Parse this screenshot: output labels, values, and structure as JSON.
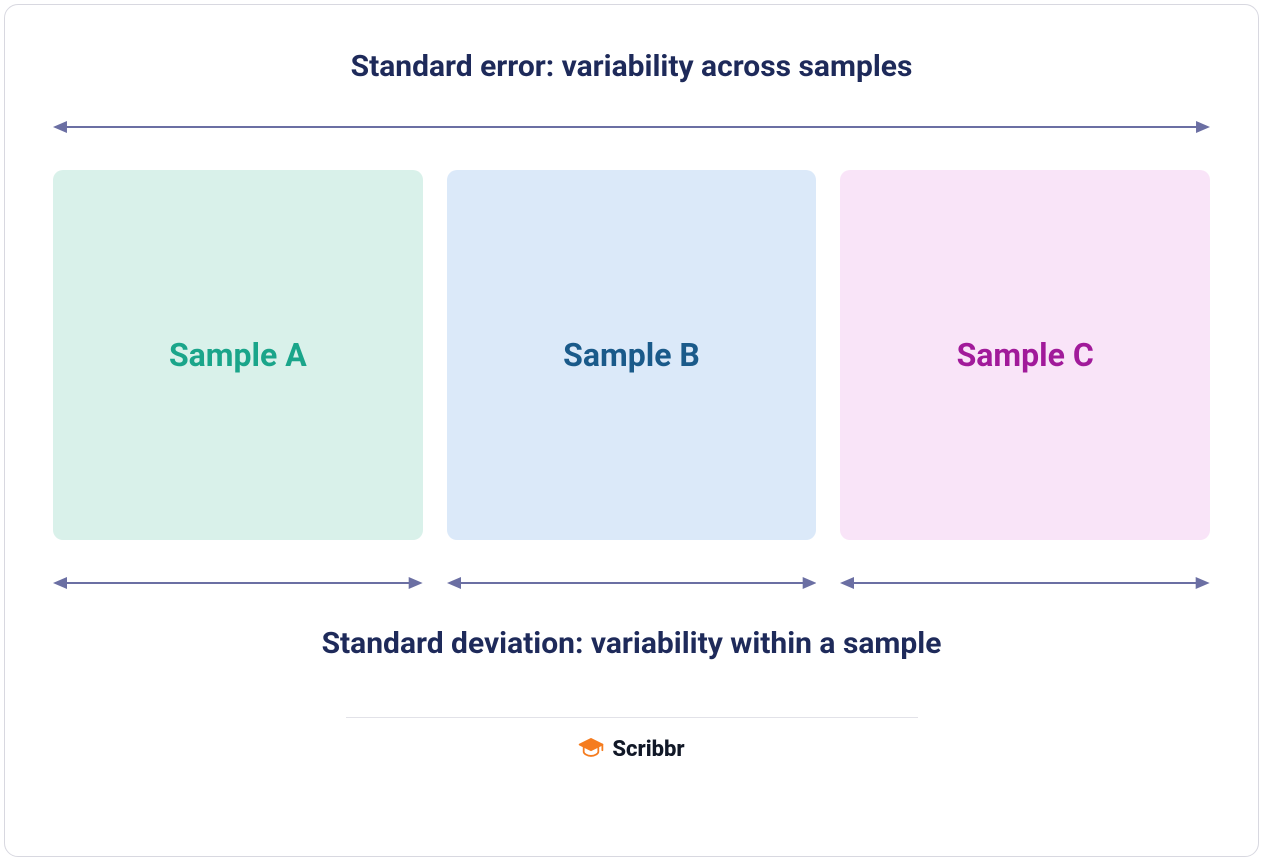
{
  "colors": {
    "heading": "#1e2a5a",
    "arrow": "#6b6fa3",
    "brand_icon": "#f57c1f",
    "brand_text": "#111827"
  },
  "top_label": "Standard error: variability across samples",
  "bottom_label": "Standard deviation: variability within a sample",
  "samples": [
    {
      "label": "Sample A",
      "bg": "#d9f1ea",
      "text": "#1aa58a"
    },
    {
      "label": "Sample B",
      "bg": "#dbe9f9",
      "text": "#1a5a8a"
    },
    {
      "label": "Sample C",
      "bg": "#f9e4f8",
      "text": "#a11a9a"
    }
  ],
  "brand": "Scribbr"
}
